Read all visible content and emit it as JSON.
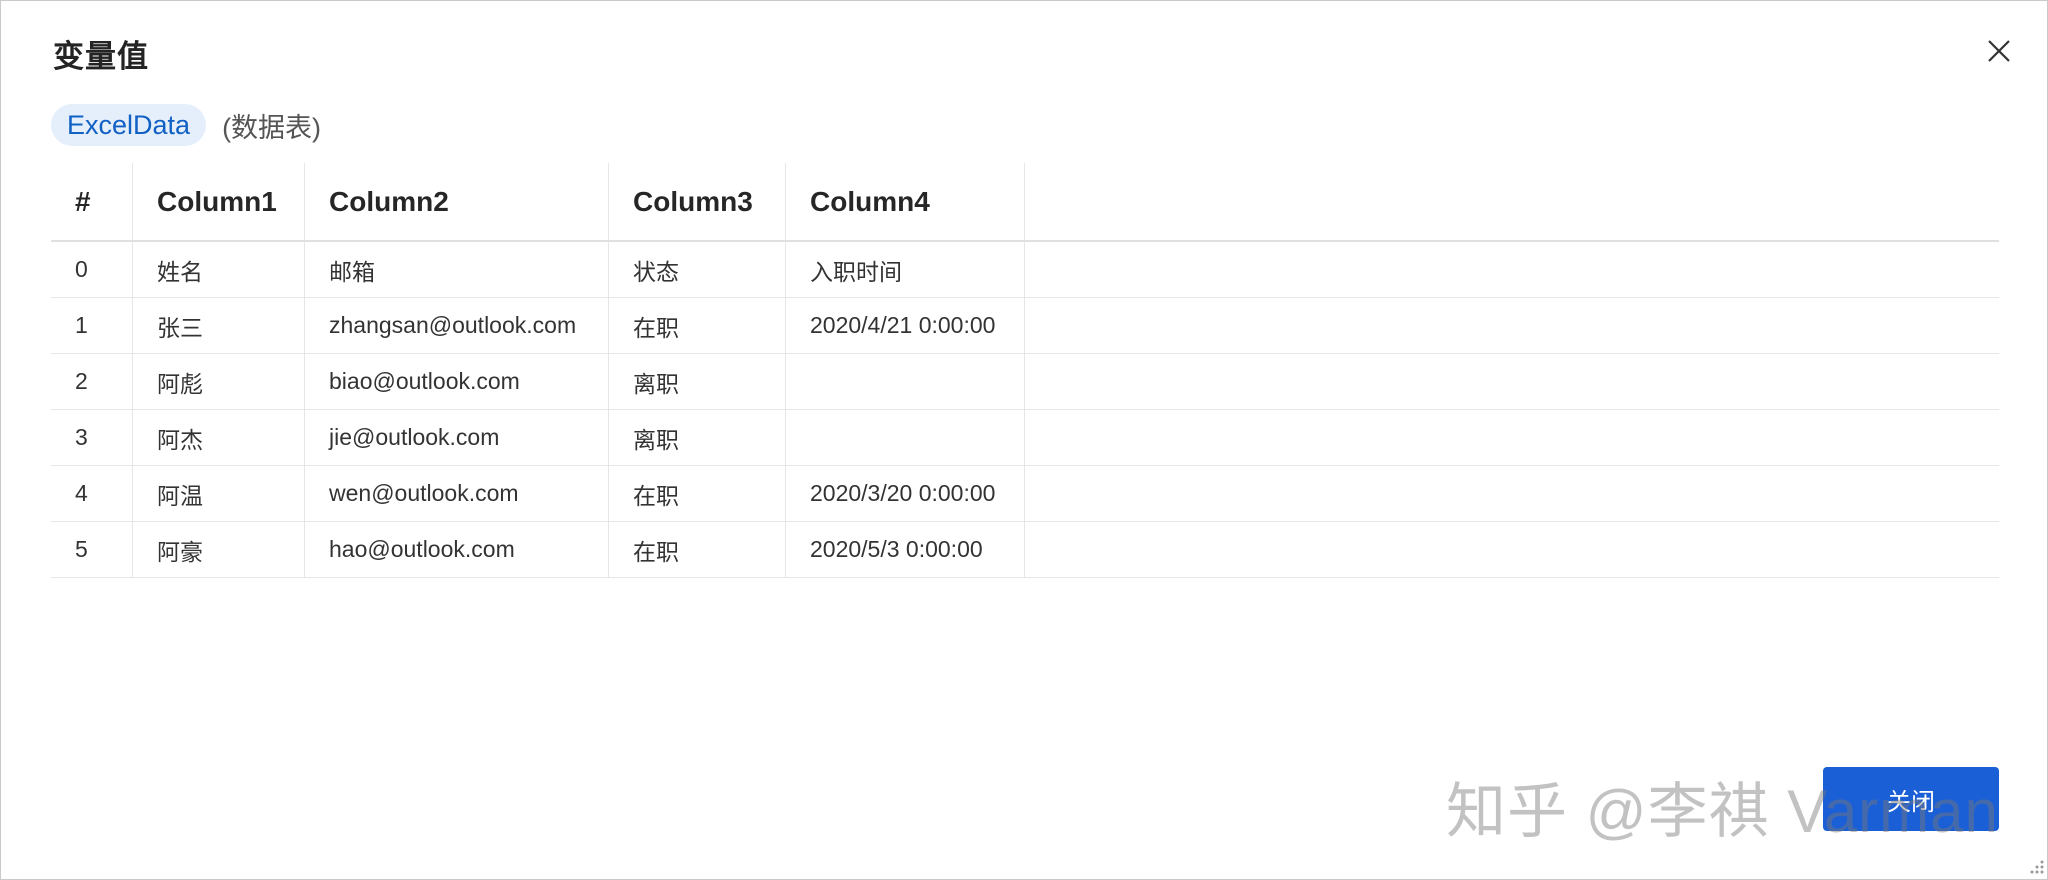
{
  "dialog": {
    "title": "变量值",
    "close_icon": "close-icon",
    "variable_name": "ExcelData",
    "variable_type": "(数据表)",
    "close_button_label": "关闭",
    "watermark": "知乎 @李祺 Varman"
  },
  "table": {
    "columns": [
      "#",
      "Column1",
      "Column2",
      "Column3",
      "Column4"
    ],
    "rows": [
      [
        "0",
        "姓名",
        "邮箱",
        "状态",
        "入职时间"
      ],
      [
        "1",
        "张三",
        "zhangsan@outlook.com",
        "在职",
        "2020/4/21 0:00:00"
      ],
      [
        "2",
        "阿彪",
        "biao@outlook.com",
        "离职",
        ""
      ],
      [
        "3",
        "阿杰",
        "jie@outlook.com",
        "离职",
        ""
      ],
      [
        "4",
        "阿温",
        "wen@outlook.com",
        "在职",
        "2020/3/20 0:00:00"
      ],
      [
        "5",
        "阿豪",
        "hao@outlook.com",
        "在职",
        "2020/5/3 0:00:00"
      ]
    ]
  },
  "colors": {
    "accent": "#1a5fd6",
    "tag_bg": "#e5effb",
    "tag_text": "#1160c4"
  }
}
